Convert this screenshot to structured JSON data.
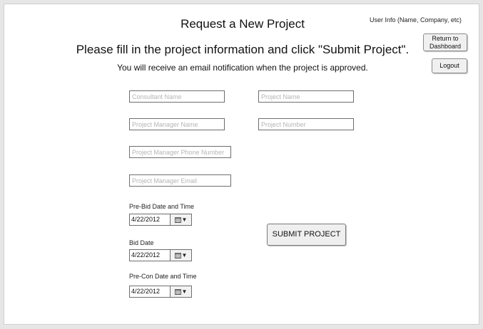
{
  "header": {
    "title": "Request a New Project",
    "subtitle": "Please fill in the project information and click \"Submit Project\".",
    "note": "You will receive an email notification when the project is approved.",
    "user_info": "User Info (Name, Company, etc)"
  },
  "actions": {
    "return_label": "Return to Dashboard",
    "logout_label": "Logout",
    "submit_label": "SUBMIT PROJECT"
  },
  "form": {
    "consultant_name": {
      "placeholder": "Consultant Name",
      "value": ""
    },
    "project_name": {
      "placeholder": "Project Name",
      "value": ""
    },
    "pm_name": {
      "placeholder": "Project Manager Name",
      "value": ""
    },
    "project_number": {
      "placeholder": "Project Number",
      "value": ""
    },
    "pm_phone": {
      "placeholder": "Project Manager Phone Number",
      "value": ""
    },
    "pm_email": {
      "placeholder": "Project Manager Email",
      "value": ""
    },
    "prebid": {
      "label": "Pre-Bid Date and Time",
      "value": "4/22/2012"
    },
    "bid": {
      "label": "Bid Date",
      "value": "4/22/2012"
    },
    "precon": {
      "label": "Pre-Con Date and Time",
      "value": "4/22/2012"
    }
  },
  "icons": {
    "calendar": "calendar-icon",
    "dropdown": "chevron-down-icon"
  }
}
